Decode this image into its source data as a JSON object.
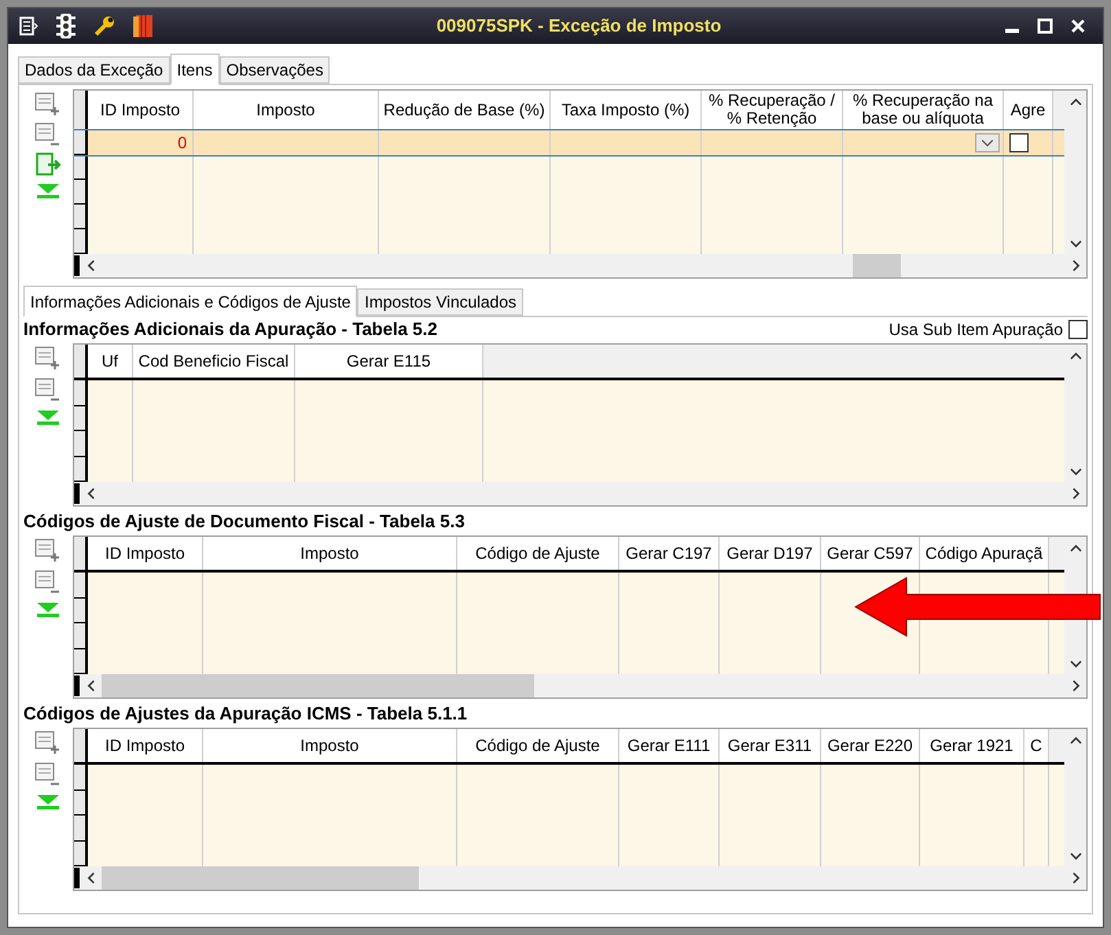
{
  "window": {
    "title": "009075SPK - Exceção de Imposto"
  },
  "tabs": [
    {
      "label": "Dados da Exceção",
      "selected": false
    },
    {
      "label": "Itens",
      "selected": true
    },
    {
      "label": "Observações",
      "selected": false
    }
  ],
  "items_table": {
    "columns": [
      "ID Imposto",
      "Imposto",
      "Redução de Base (%)",
      "Taxa Imposto (%)",
      "% Recuperação / % Retenção",
      "% Recuperação na base ou alíquota",
      "Agre"
    ],
    "rows": [
      {
        "selected": true,
        "id_imposto": "0",
        "column_7_checked": false
      }
    ]
  },
  "sub_tabs": [
    {
      "label": "Informações Adicionais e Códigos de Ajuste",
      "selected": true
    },
    {
      "label": "Impostos Vinculados",
      "selected": false
    }
  ],
  "sections": [
    {
      "title": "Informações Adicionais da Apuração - Tabela 5.2",
      "option": {
        "label": "Usa Sub Item Apuração",
        "checked": false
      },
      "columns": [
        "Uf",
        "Cod Beneficio Fiscal",
        "Gerar E115"
      ]
    },
    {
      "title": "Códigos de Ajuste de Documento Fiscal - Tabela 5.3",
      "columns": [
        "ID Imposto",
        "Imposto",
        "Código de Ajuste",
        "Gerar C197",
        "Gerar D197",
        "Gerar C597",
        "Código Apuraçã"
      ]
    },
    {
      "title": "Códigos de Ajustes da Apuração ICMS - Tabela 5.1.1",
      "columns": [
        "ID Imposto",
        "Imposto",
        "Código de Ajuste",
        "Gerar E111",
        "Gerar E311",
        "Gerar E220",
        "Gerar 1921",
        "C"
      ]
    }
  ]
}
